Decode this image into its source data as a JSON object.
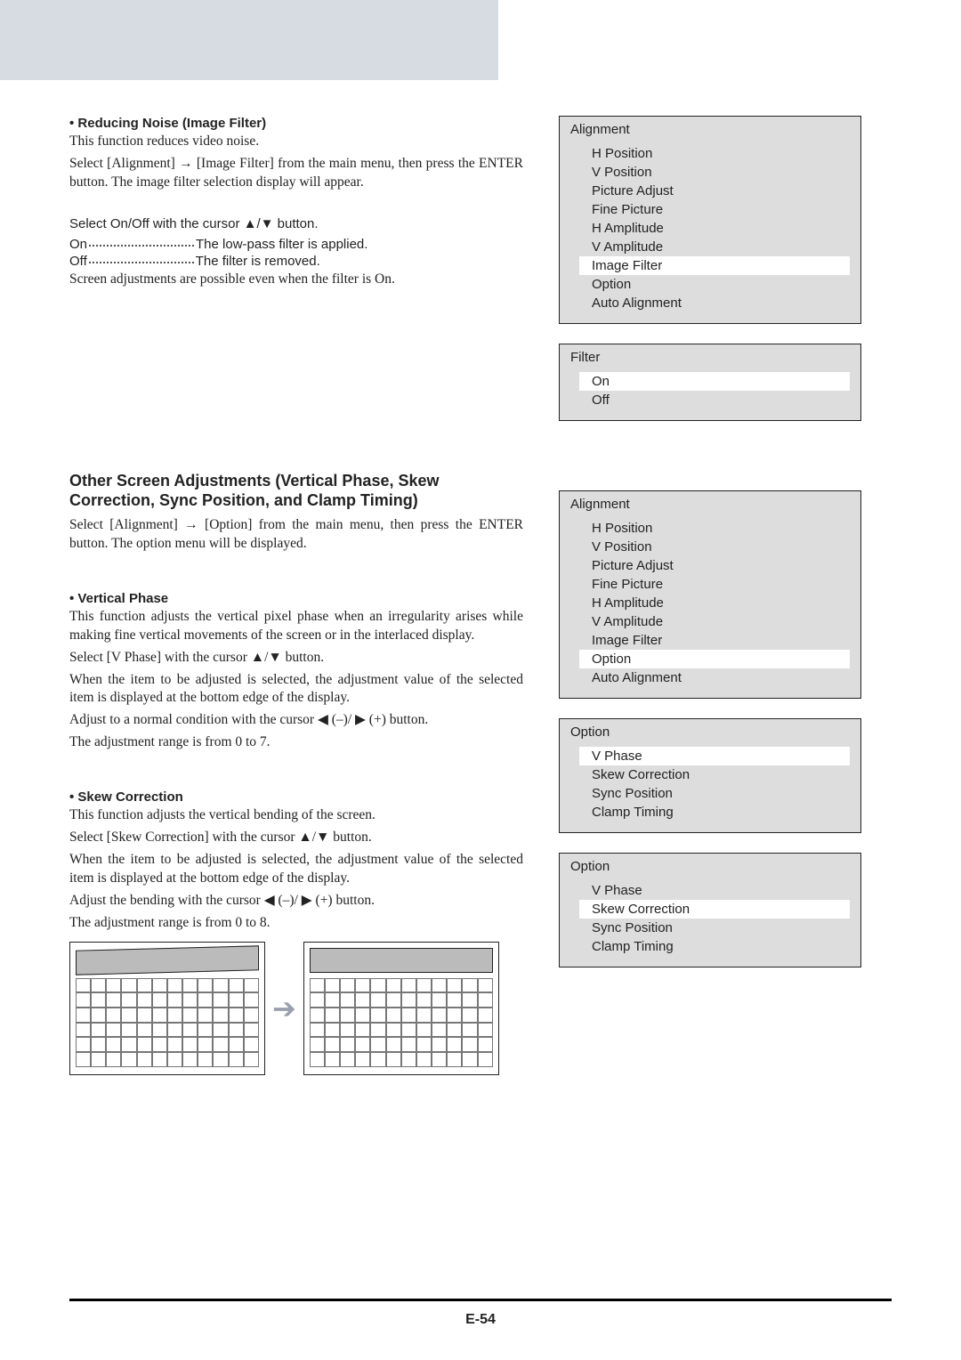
{
  "pageNumber": "E-54",
  "noise": {
    "heading": "• Reducing Noise (Image Filter)",
    "intro": "This function reduces video noise.",
    "path": "Select [Alignment] → [Image Filter] from the main menu, then press the ENTER button. The image filter selection display will appear.",
    "selectLine": "Select On/Off with the cursor ▲/▼ button.",
    "on_label": "On",
    "on_desc": "The low-pass filter is applied.",
    "off_label": "Off",
    "off_desc": "The filter is removed.",
    "note": "Screen adjustments are possible even when the filter is On."
  },
  "alignment1": {
    "title": "Alignment",
    "items": [
      "H Position",
      "V Position",
      "Picture Adjust",
      "Fine Picture",
      "H Amplitude",
      "V Amplitude",
      "Image Filter",
      "Option",
      "Auto Alignment"
    ],
    "selected": "Image Filter"
  },
  "filterMenu": {
    "title": "Filter",
    "items": [
      "On",
      "Off"
    ],
    "selected": "On"
  },
  "other": {
    "heading": "Other Screen Adjustments (Vertical Phase, Skew Correction, Sync Position, and Clamp Timing)",
    "path": "Select [Alignment] → [Option] from the main menu, then press the ENTER button. The option menu will be displayed."
  },
  "vphase": {
    "heading": "• Vertical Phase",
    "p1": "This function adjusts the vertical pixel phase when an irregularity arises while making fine vertical movements of the screen or in the interlaced display.",
    "p2": "Select [V Phase] with the cursor ▲/▼ button.",
    "p3": "When the item to be adjusted is selected, the adjustment value of the selected item is displayed at the bottom edge of the display.",
    "p4": "Adjust to a normal condition with the cursor ◀ (–)/ ▶ (+) button.",
    "p5": "The adjustment range is from 0 to 7."
  },
  "skew": {
    "heading": "• Skew Correction",
    "p1": "This function adjusts the vertical bending of the screen.",
    "p2": "Select [Skew Correction] with the cursor ▲/▼ button.",
    "p3": "When the item to be adjusted is selected, the adjustment value of the selected item is displayed at the bottom edge of the display.",
    "p4": "Adjust the bending with the cursor ◀ (–)/ ▶ (+) button.",
    "p5": "The adjustment range is from 0 to 8."
  },
  "alignment2": {
    "title": "Alignment",
    "items": [
      "H Position",
      "V Position",
      "Picture Adjust",
      "Fine Picture",
      "H Amplitude",
      "V Amplitude",
      "Image Filter",
      "Option",
      "Auto Alignment"
    ],
    "selected": "Option"
  },
  "option1": {
    "title": "Option",
    "items": [
      "V Phase",
      "Skew Correction",
      "Sync Position",
      "Clamp Timing"
    ],
    "selected": "V Phase"
  },
  "option2": {
    "title": "Option",
    "items": [
      "V Phase",
      "Skew Correction",
      "Sync Position",
      "Clamp Timing"
    ],
    "selected": "Skew Correction"
  },
  "arrowGlyph": "➔"
}
